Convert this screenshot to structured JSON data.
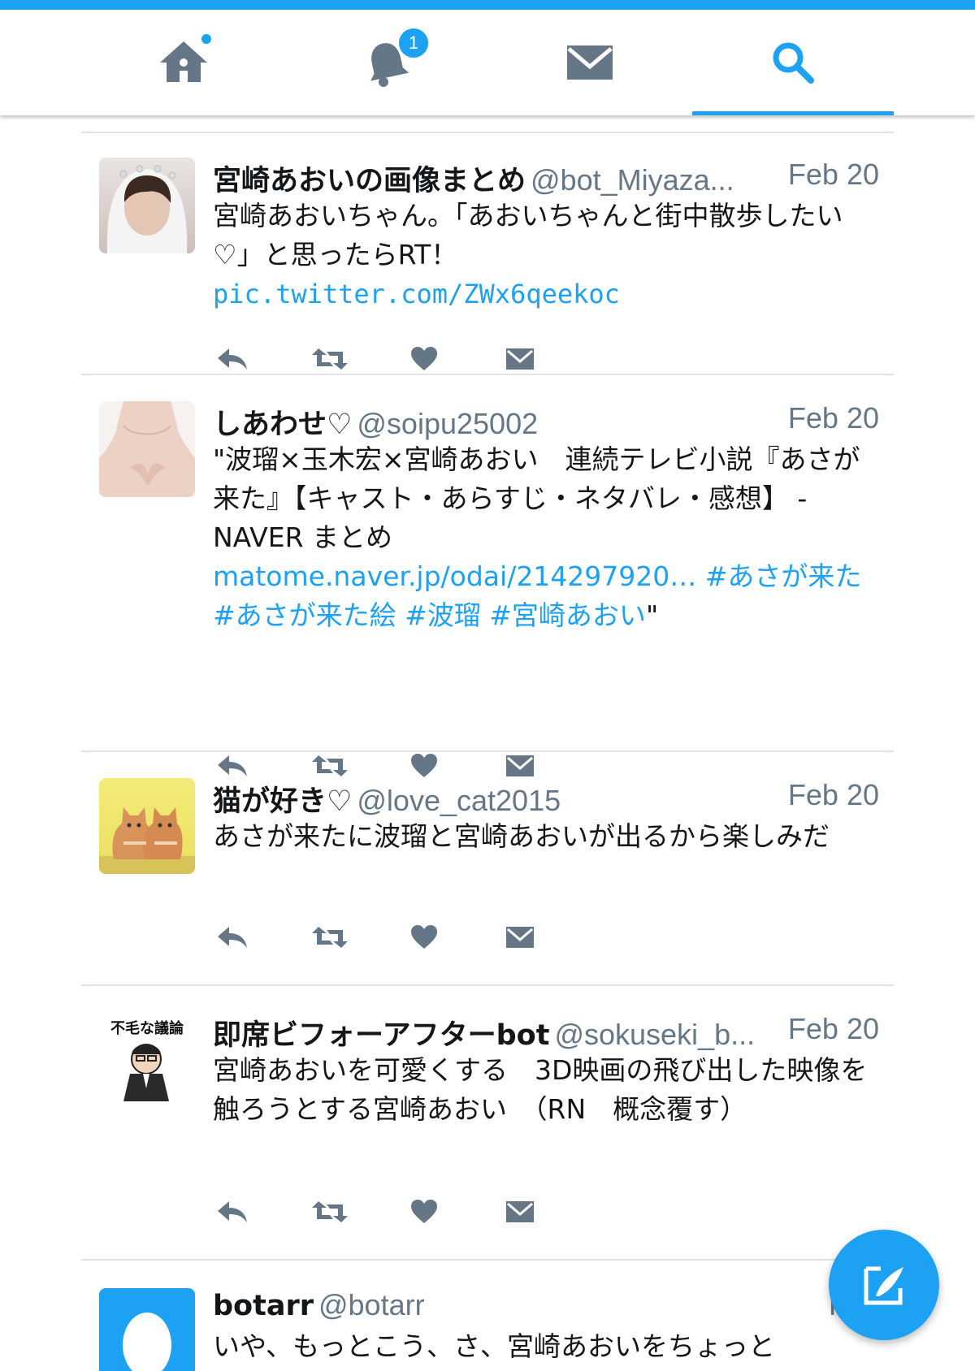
{
  "nav": {
    "tabs": [
      {
        "name": "home",
        "icon": "home-icon",
        "badge": "dot"
      },
      {
        "name": "notifications",
        "icon": "bell-icon",
        "badge": "1"
      },
      {
        "name": "messages",
        "icon": "envelope-icon"
      },
      {
        "name": "search",
        "icon": "search-icon",
        "active": true
      }
    ]
  },
  "colors": {
    "accent": "#1da1f2",
    "icon_gray": "#657786",
    "separator": "#dde3e8"
  },
  "tweets": [
    {
      "name": "宮崎あおいの画像まとめ",
      "handle": "@bot_Miyaza...",
      "date": "Feb 20",
      "text": "宮崎あおいちゃん。「あおいちゃんと街中散歩したい♡」と思ったらRT！",
      "link": "pic.twitter.com/ZWx6qeekoc",
      "avatar": "photo"
    },
    {
      "name": "しあわせ♡",
      "handle": "@soipu25002",
      "date": "Feb 20",
      "text": "\"波瑠×玉木宏×宮崎あおい　連続テレビ小説『あさが来た』【キャスト・あらすじ・ネタバレ・感想】 - NAVER まとめ",
      "link": "matome.naver.jp/odai/214297920… #あさが来た #あさが来た絵 #波瑠 #宮崎あおい",
      "text_end": "\"",
      "avatar": "photo"
    },
    {
      "name": "猫が好き♡",
      "handle": "@love_cat2015",
      "date": "Feb 20",
      "text": "あさが来たに波瑠と宮崎あおいが出るから楽しみだ",
      "avatar": "kittens"
    },
    {
      "name": "即席ビフォーアフターbot",
      "handle": "@sokuseki_b...",
      "date": "Feb 20",
      "text": "宮崎あおいを可愛くする　3D映画の飛び出した映像を触ろうとする宮崎あおい　（RN　概念覆す）",
      "avatar_text": "不毛な議論",
      "avatar": "illustration"
    },
    {
      "name": "botarr",
      "handle": "@botarr",
      "date": "Feb",
      "text": "いや、もっとこう、さ、宮崎あおいをちょっと",
      "avatar": "egg"
    }
  ],
  "compose": {
    "icon": "compose-icon"
  }
}
